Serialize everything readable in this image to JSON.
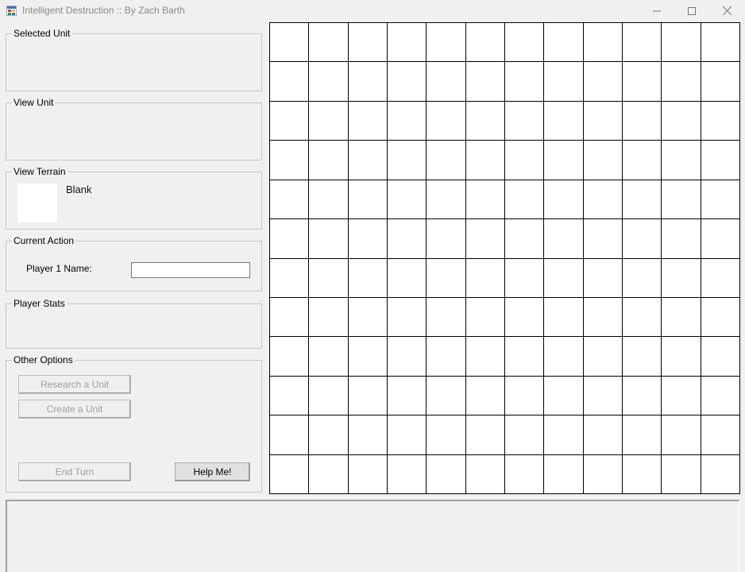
{
  "window": {
    "title": "Intelligent Destruction :: By Zach Barth",
    "icon": "app-icon"
  },
  "groups": {
    "selected_unit": "Selected Unit",
    "view_unit": "View Unit",
    "view_terrain": "View Terrain",
    "current_action": "Current Action",
    "player_stats": "Player Stats",
    "other_options": "Other Options"
  },
  "terrain": {
    "name": "Blank",
    "swatch_color": "#ffffff"
  },
  "current_action": {
    "label": "Player 1 Name:",
    "value": ""
  },
  "buttons": {
    "research": "Research a Unit",
    "create": "Create a Unit",
    "end_turn": "End Turn",
    "help": "Help Me!"
  },
  "board": {
    "rows": 12,
    "cols": 12
  },
  "log": {
    "text": ""
  }
}
